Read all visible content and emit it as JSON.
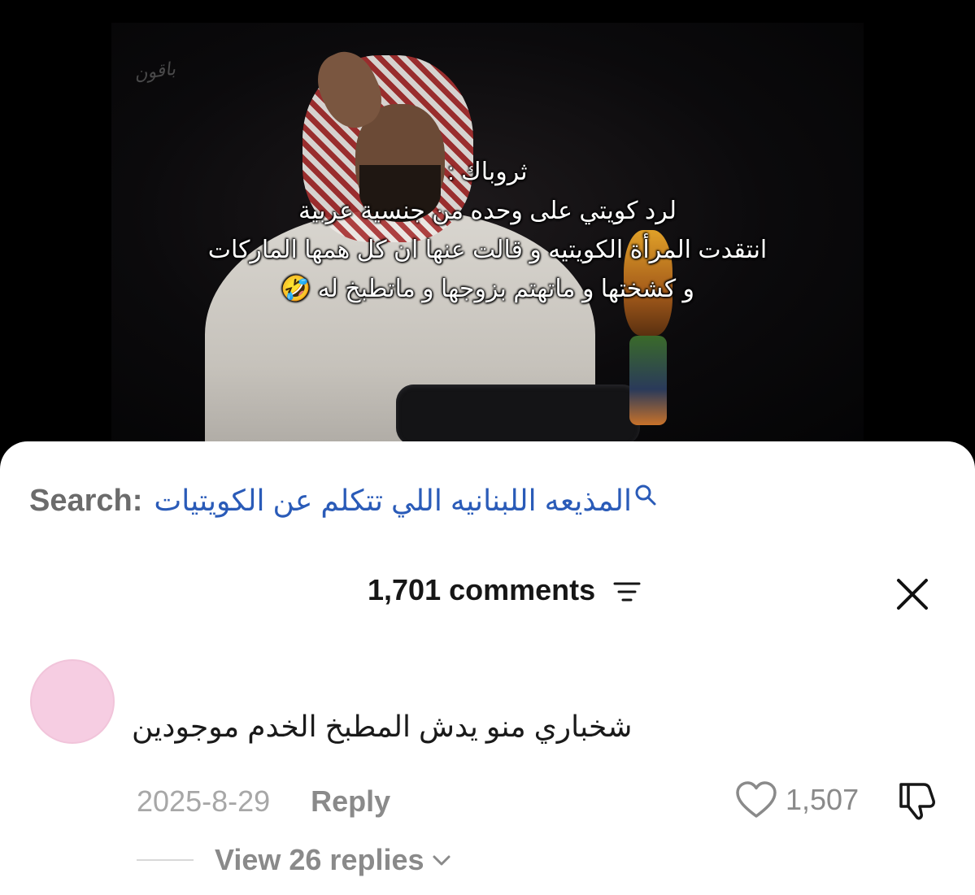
{
  "video": {
    "watermark": "باقون",
    "caption_lines": [
      "ثروباك :",
      "لرد كويتي على وحده من جنسية عربية",
      "انتقدت المرأة الكويتيه و قالت عنها ان كل همها الماركات",
      "و كشختها و ماتهتم بزوجها و ماتطبخ له 🤣"
    ]
  },
  "search": {
    "label": "Search:",
    "query": "المذيعه اللبنانيه اللي تتكلم عن الكويتيات",
    "icon": "search-icon"
  },
  "comments_header": {
    "count_label": "1,701 comments",
    "filter_icon": "filter-icon",
    "close_icon": "close-icon"
  },
  "comment": {
    "avatar_color": "#f6cde2",
    "text": "شخباري منو يدش المطبخ الخدم موجودين",
    "date": "2025-8-29",
    "reply_label": "Reply",
    "likes": "1,507",
    "view_replies_label": "View 26 replies"
  },
  "colors": {
    "search_query": "#2a5bb8",
    "muted_text": "#8a8a8a",
    "sheet_background": "#ffffff"
  }
}
